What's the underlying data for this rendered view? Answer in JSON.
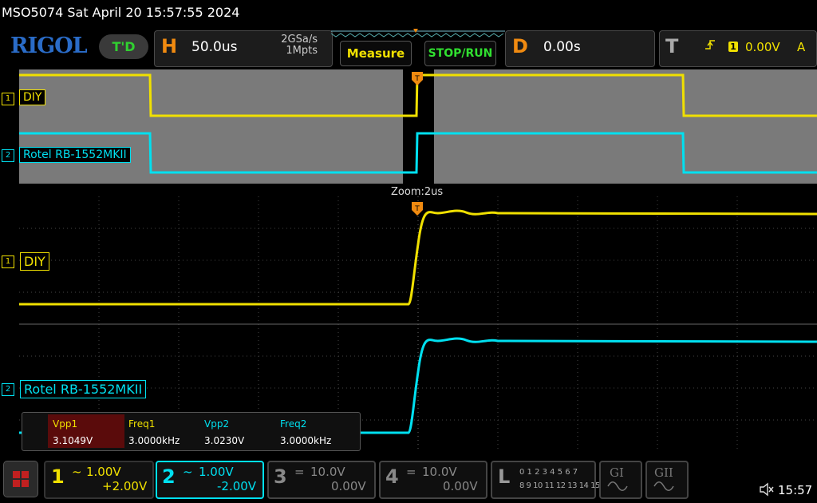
{
  "header": {
    "model_time": "MSO5074  Sat April 20 15:57:55 2024",
    "logo": "RIGOL",
    "td_badge": "T'D"
  },
  "horizontal": {
    "letter": "H",
    "timebase": "50.0us",
    "sample_rate": "2GSa/s",
    "memory": "1Mpts"
  },
  "buttons": {
    "measure": "Measure",
    "stop_run": "STOP/RUN"
  },
  "delay": {
    "letter": "D",
    "value": "0.00s"
  },
  "trigger": {
    "letter": "T",
    "source": "1",
    "level": "0.00V",
    "mode": "A"
  },
  "zoom_label": "Zoom:2us",
  "channels": [
    {
      "id": "1",
      "label": "DIY",
      "color": "#f0e000"
    },
    {
      "id": "2",
      "label": "Rotel RB-1552MKII",
      "color": "#00e0f0"
    }
  ],
  "measurements": {
    "headers": [
      "Vpp1",
      "Freq1",
      "Vpp2",
      "Freq2"
    ],
    "values": [
      "3.1049V",
      "3.0000kHz",
      "3.0230V",
      "3.0000kHz"
    ]
  },
  "channel_bar": [
    {
      "num": "1",
      "scale": "1.00V",
      "offset": "+2.00V",
      "coupling": "~",
      "color": "#f0e000",
      "active": true
    },
    {
      "num": "2",
      "scale": "1.00V",
      "offset": "-2.00V",
      "coupling": "~",
      "color": "#00e0f0",
      "active": true
    },
    {
      "num": "3",
      "scale": "10.0V",
      "offset": "0.00V",
      "coupling": "=",
      "color": "#888888",
      "active": false
    },
    {
      "num": "4",
      "scale": "10.0V",
      "offset": "0.00V",
      "coupling": "=",
      "color": "#888888",
      "active": false
    }
  ],
  "logic": {
    "letter": "L",
    "row1": "0 1 2 3  4 5 6 7",
    "row2": "8 9 10 11 12 13 14 15"
  },
  "generators": [
    "GI",
    "GII"
  ],
  "clock": "15:57"
}
